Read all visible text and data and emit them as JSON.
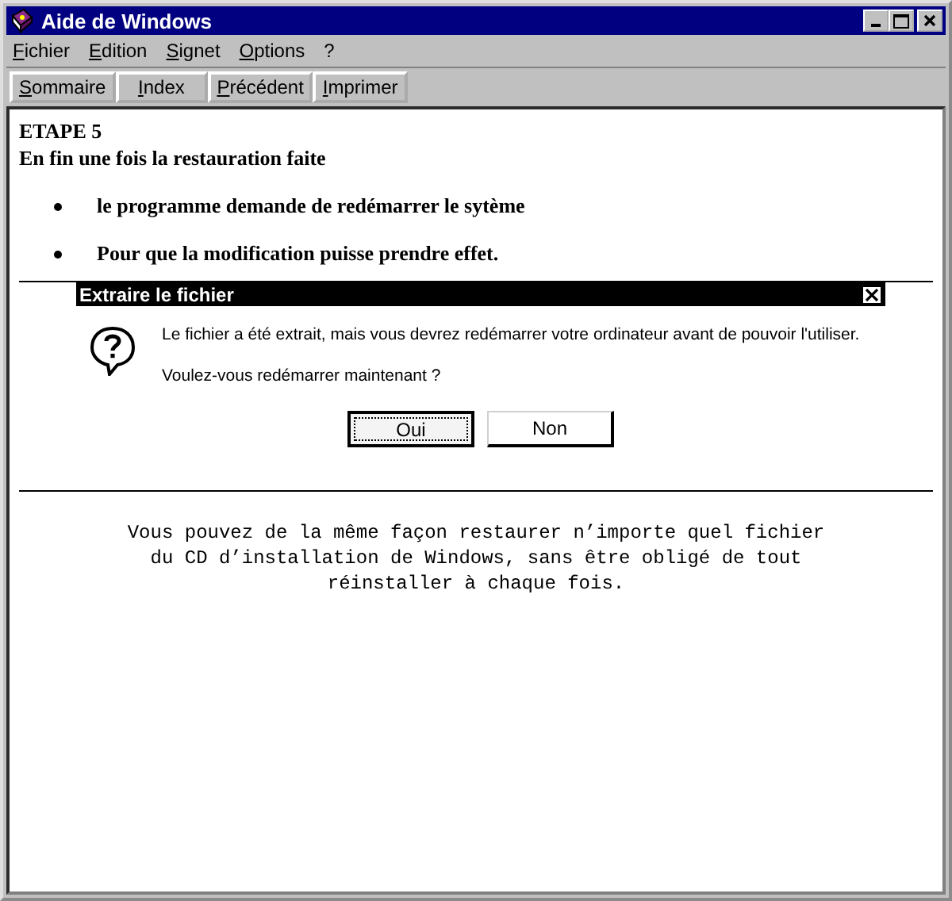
{
  "window": {
    "title": "Aide de Windows"
  },
  "menu": [
    "Fichier",
    "Edition",
    "Signet",
    "Options",
    "?"
  ],
  "toolbar": [
    "Sommaire",
    "Index",
    "Précédent",
    "Imprimer"
  ],
  "content": {
    "heading": "ETAPE 5",
    "intro": "En fin une fois la restauration faite",
    "bullets": [
      "le programme demande de redémarrer le sytème",
      "Pour que la modification puisse prendre effet."
    ]
  },
  "dialog": {
    "title": "Extraire le fichier",
    "message": "Le fichier a été extrait, mais vous devrez redémarrer votre ordinateur avant de pouvoir l'utiliser.",
    "question": "Voulez-vous redémarrer maintenant ?",
    "buttons": [
      {
        "label": "Oui",
        "focused": true
      },
      {
        "label": "Non",
        "focused": false
      }
    ]
  },
  "footer_text": "Vous pouvez de la même façon restaurer n’importe quel fichier du CD d’installation de Windows, sans être obligé de tout réinstaller à chaque fois."
}
